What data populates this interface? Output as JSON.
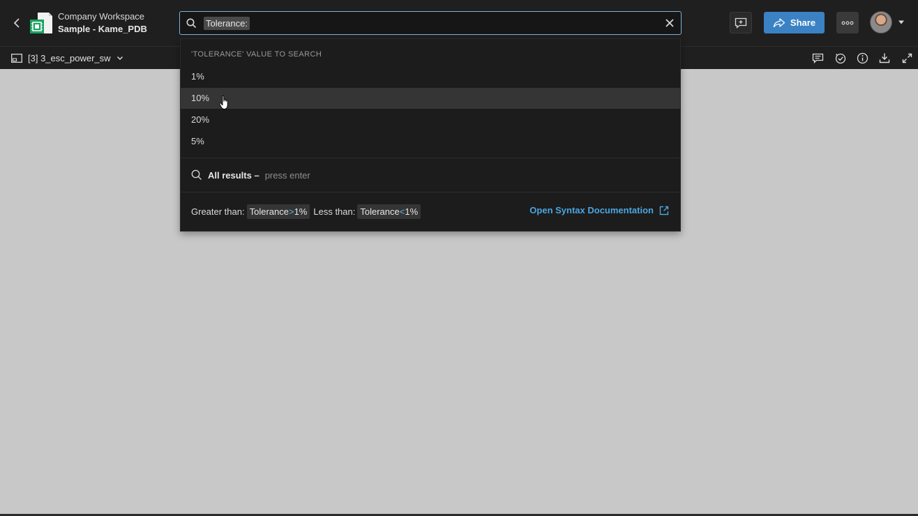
{
  "header": {
    "workspace": "Company Workspace",
    "document": "Sample - Kame_PDB",
    "share_label": "Share"
  },
  "search": {
    "token": "Tolerance:"
  },
  "subbar": {
    "sheet_label": "[3] 3_esc_power_sw"
  },
  "dropdown": {
    "heading": "'TOLERANCE' VALUE TO SEARCH",
    "items": [
      "1%",
      "10%",
      "20%",
      "5%"
    ],
    "hovered_index": 1,
    "all_results_label": "All results –",
    "all_results_hint": "press enter",
    "greater_than_label": "Greater than:",
    "greater_chip_field": "Tolerance",
    "greater_chip_op": ">",
    "greater_chip_value": "1%",
    "less_than_label": "Less than:",
    "less_chip_field": "Tolerance",
    "less_chip_op": "<",
    "less_chip_value": "1%",
    "syntax_link": "Open Syntax Documentation"
  },
  "colors": {
    "accent": "#3a82c4",
    "link": "#4aa6e0",
    "canvas": "#c8c8c8",
    "chrome": "#1f1f1f"
  }
}
